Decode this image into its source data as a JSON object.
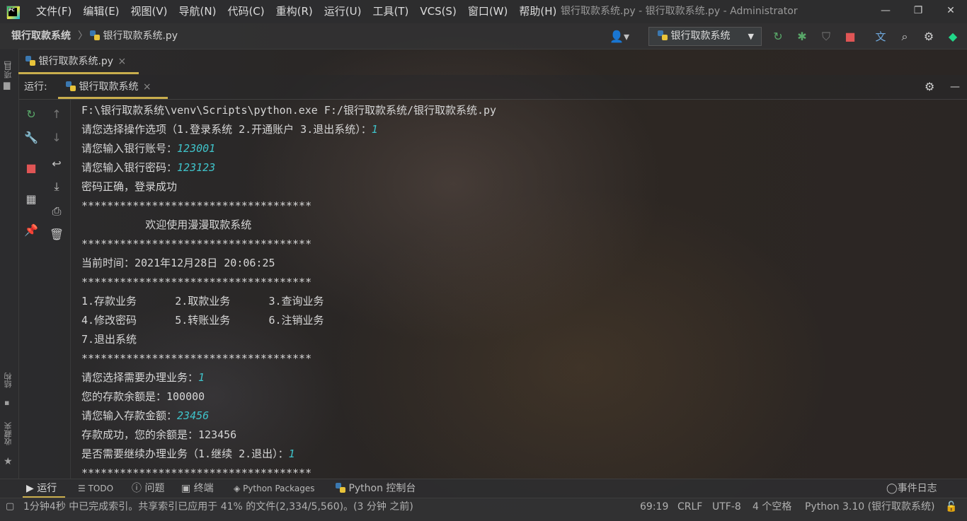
{
  "titlebar": {
    "logo_text": "PC",
    "menu": [
      "文件(F)",
      "编辑(E)",
      "视图(V)",
      "导航(N)",
      "代码(C)",
      "重构(R)",
      "运行(U)",
      "工具(T)",
      "VCS(S)",
      "窗口(W)",
      "帮助(H)"
    ],
    "window_title": "银行取款系统.py - 银行取款系统.py - Administrator",
    "minimize": "—",
    "maximize": "❐",
    "close": "✕"
  },
  "navbar": {
    "project": "银行取款系统",
    "separator": "〉",
    "file": "银行取款系统.py",
    "run_config": "银行取款系统"
  },
  "editor_tab": {
    "label": "银行取款系统.py",
    "close": "×"
  },
  "left_strip": {
    "project_label": "项目",
    "structure_label": "结构",
    "favorites_label": "收藏夹"
  },
  "run_panel": {
    "label": "运行:",
    "tab_label": "银行取款系统",
    "close": "×",
    "minimize": "—"
  },
  "console": {
    "lines": [
      {
        "text": "F:\\银行取款系统\\venv\\Scripts\\python.exe F:/银行取款系统/银行取款系统.py",
        "input": ""
      },
      {
        "text": "请您选择操作选项（1.登录系统 2.开通账户 3.退出系统）：",
        "input": "1"
      },
      {
        "text": "请您输入银行账号：",
        "input": "123001"
      },
      {
        "text": "请您输入银行密码：",
        "input": "123123"
      },
      {
        "text": "密码正确，登录成功",
        "input": ""
      },
      {
        "text": "************************************",
        "input": ""
      },
      {
        "text": "          欢迎使用漫漫取款系统",
        "input": ""
      },
      {
        "text": "************************************",
        "input": ""
      },
      {
        "text": "当前时间：2021年12月28日 20:06:25",
        "input": ""
      },
      {
        "text": "************************************",
        "input": ""
      },
      {
        "text": "1.存款业务      2.取款业务      3.查询业务",
        "input": ""
      },
      {
        "text": "4.修改密码      5.转账业务      6.注销业务",
        "input": ""
      },
      {
        "text": "7.退出系统",
        "input": ""
      },
      {
        "text": "************************************",
        "input": ""
      },
      {
        "text": "请您选择需要办理业务：",
        "input": "1"
      },
      {
        "text": "您的存款余额是：100000",
        "input": ""
      },
      {
        "text": "请您输入存款金额：",
        "input": "23456"
      },
      {
        "text": "存款成功，您的余额是：123456",
        "input": ""
      },
      {
        "text": "是否需要继续办理业务（1.继续 2.退出）：",
        "input": "1"
      },
      {
        "text": "************************************",
        "input": ""
      }
    ]
  },
  "bottom_bar": {
    "run": "运行",
    "todo": "TODO",
    "problems": "问题",
    "terminal": "终端",
    "packages": "Python Packages",
    "console": "Python 控制台",
    "event_log": "事件日志"
  },
  "status_bar": {
    "message": "1分钟4秒 中已完成索引。共享索引已应用于 41% 的文件(2,334/5,560)。(3 分钟 之前)",
    "position": "69:19",
    "line_sep": "CRLF",
    "encoding": "UTF-8",
    "indent": "4 个空格",
    "interpreter": "Python 3.10 (银行取款系统)"
  },
  "colors": {
    "input_text": "#3fc2c9",
    "tab_underline": "#c9ae4d",
    "run_green": "#59a869",
    "stop_red": "#e05555"
  }
}
